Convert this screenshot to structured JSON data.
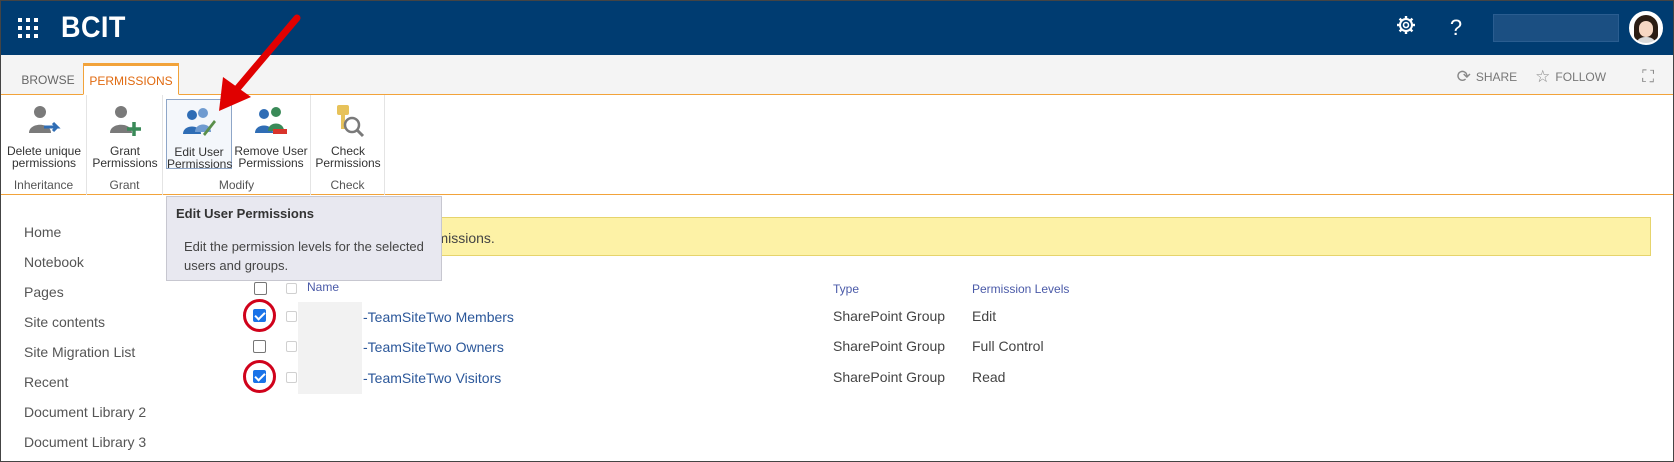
{
  "suite": {
    "brand": "BCIT",
    "help_label": "?",
    "colors": {
      "bar": "#003C71",
      "accent": "#f2a33a"
    }
  },
  "tabs": {
    "browse": "BROWSE",
    "permissions": "PERMISSIONS",
    "share": "SHARE",
    "follow": "FOLLOW"
  },
  "ribbon": {
    "groups": {
      "inheritance": "Inheritance",
      "grant": "Grant",
      "modify": "Modify",
      "check": "Check"
    },
    "buttons": {
      "delete_unique": {
        "line1": "Delete unique",
        "line2": "permissions"
      },
      "grant": {
        "line1": "Grant",
        "line2": "Permissions"
      },
      "edit_user": {
        "line1": "Edit User",
        "line2": "Permissions"
      },
      "remove_user": {
        "line1": "Remove User",
        "line2": "Permissions"
      },
      "check": {
        "line1": "Check",
        "line2": "Permissions"
      }
    }
  },
  "tooltip": {
    "title": "Edit User Permissions",
    "text": "Edit the permission levels for the selected users and groups."
  },
  "banner": {
    "text": "ermissions."
  },
  "leftnav": {
    "items": [
      "Home",
      "Notebook",
      "Pages",
      "Site contents",
      "Site Migration List",
      "Recent",
      "Document Library 2",
      "Document Library 3"
    ]
  },
  "table": {
    "headers": {
      "name": "Name",
      "type": "Type",
      "levels": "Permission Levels"
    },
    "rows": [
      {
        "name": "-TeamSiteTwo Members",
        "type": "SharePoint Group",
        "level": "Edit",
        "checked": true
      },
      {
        "name": "-TeamSiteTwo Owners",
        "type": "SharePoint Group",
        "level": "Full Control",
        "checked": false
      },
      {
        "name": "-TeamSiteTwo Visitors",
        "type": "SharePoint Group",
        "level": "Read",
        "checked": true
      }
    ]
  },
  "annotations": {
    "arrow_color": "#e00000",
    "ring_color": "#d0021b"
  }
}
